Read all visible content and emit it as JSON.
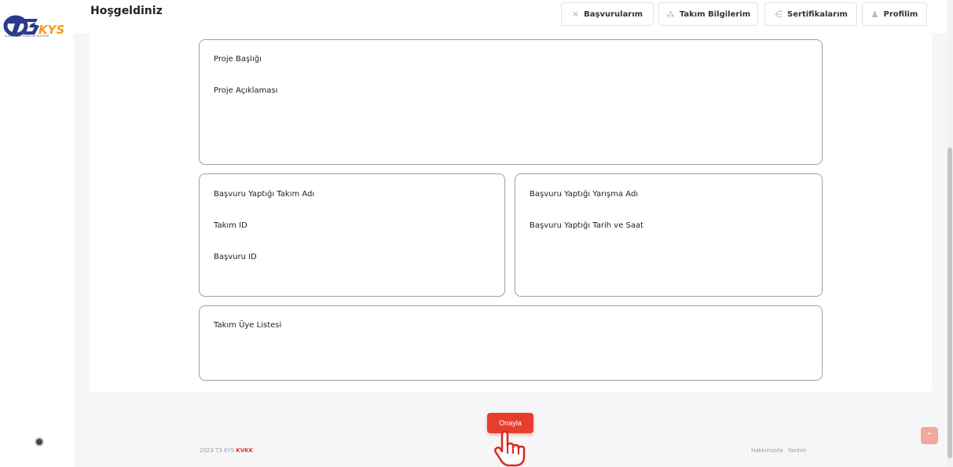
{
  "brand": {
    "logo_text": "T3KYS",
    "logo_subtitle": "KURUMSAL YÖNETİM SİSTEMİ"
  },
  "header": {
    "title": "Hoşgeldiniz",
    "nav": [
      {
        "label": "Başvurularım",
        "icon": "tools-icon"
      },
      {
        "label": "Takım Bilgilerim",
        "icon": "team-icon"
      },
      {
        "label": "Sertifikalarım",
        "icon": "share-icon"
      },
      {
        "label": "Profilim",
        "icon": "user-icon"
      }
    ]
  },
  "project": {
    "title_label": "Proje Başlığı",
    "description_label": "Proje Açıklaması"
  },
  "application": {
    "team_name_label": "Başvuru Yaptığı Takım Adı",
    "team_id_label": "Takım ID",
    "application_id_label": "Başvuru ID",
    "competition_name_label": "Başvuru Yaptığı Yarışma Adı",
    "date_time_label": "Başvuru Yaptığı Tarih ve Saat"
  },
  "team_members": {
    "label": "Takım Üye Listesi"
  },
  "actions": {
    "confirm_label": "Onayla"
  },
  "footer": {
    "copyright": "2023 T3 KYS",
    "kvkk": "KVKK",
    "about": "Hakkımızda",
    "help": "Yardım"
  },
  "colors": {
    "accent": "#e63d2e",
    "panel_border": "#9e9eae",
    "logo_blue": "#2b3a8c",
    "logo_orange": "#f39c12"
  }
}
